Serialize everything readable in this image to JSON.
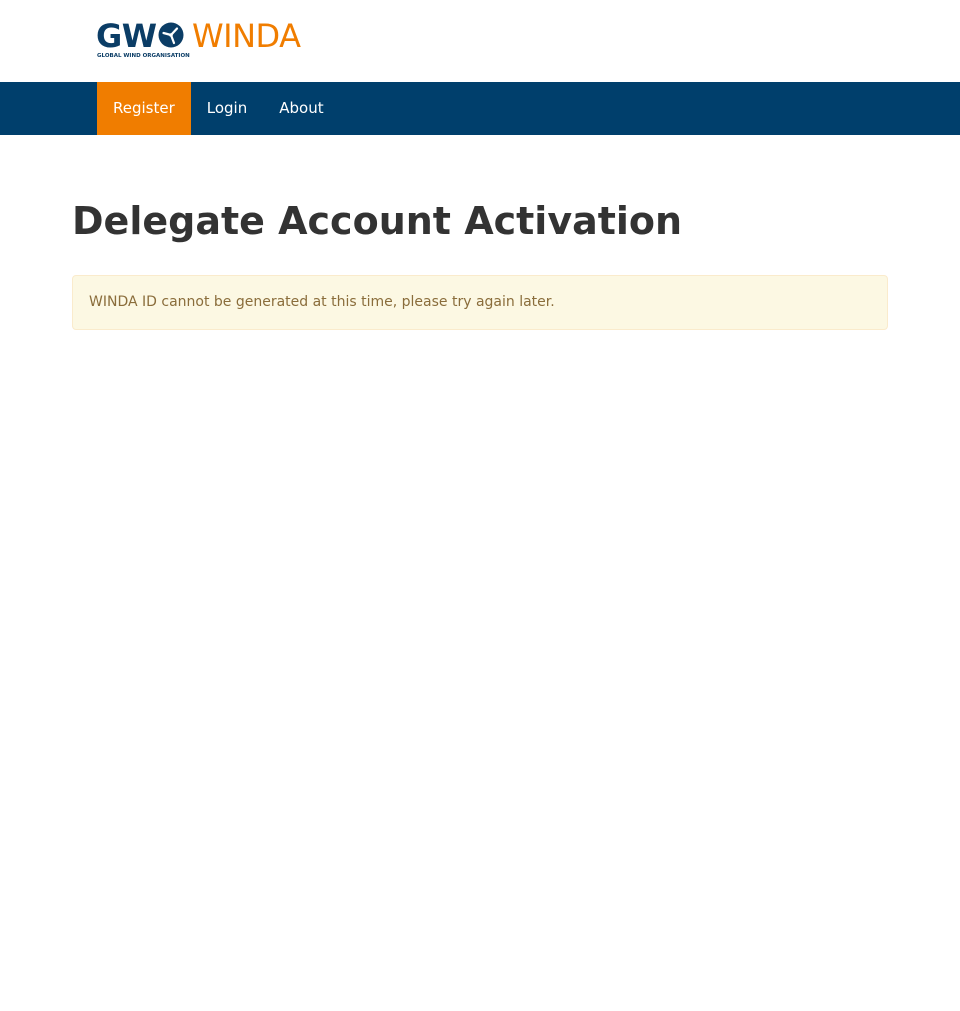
{
  "logo": {
    "gw": "GW",
    "winda": "WINDA",
    "subtitle": "GLOBAL WIND ORGANISATION",
    "turbine_icon": "wind-turbine-icon",
    "colors": {
      "navy": "#0b3d66",
      "orange": "#f07d00"
    }
  },
  "nav": {
    "items": [
      {
        "label": "Register",
        "active": true
      },
      {
        "label": "Login",
        "active": false
      },
      {
        "label": "About",
        "active": false
      }
    ],
    "background": "#003f6c",
    "active_color": "#f07d00"
  },
  "main": {
    "title": "Delegate Account Activation",
    "alert": {
      "message": "WINDA ID cannot be generated at this time, please try again later."
    }
  }
}
